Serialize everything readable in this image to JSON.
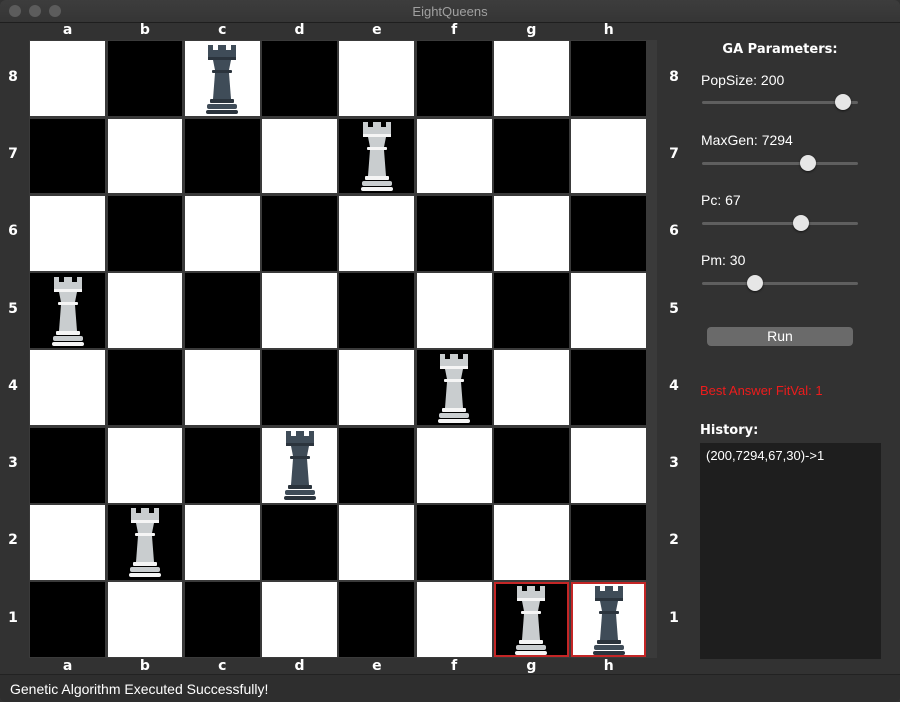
{
  "window": {
    "title": "EightQueens"
  },
  "board": {
    "files": [
      "a",
      "b",
      "c",
      "d",
      "e",
      "f",
      "g",
      "h"
    ],
    "ranks": [
      "8",
      "7",
      "6",
      "5",
      "4",
      "3",
      "2",
      "1"
    ],
    "colors": {
      "light": "#ffffff",
      "dark": "#000000",
      "highlight": "#c42626"
    },
    "pieces": [
      {
        "file": "c",
        "rank": "8",
        "piece": "rook-icon",
        "color": "dark"
      },
      {
        "file": "e",
        "rank": "7",
        "piece": "rook-icon",
        "color": "light"
      },
      {
        "file": "a",
        "rank": "5",
        "piece": "rook-icon",
        "color": "light"
      },
      {
        "file": "f",
        "rank": "4",
        "piece": "rook-icon",
        "color": "light"
      },
      {
        "file": "d",
        "rank": "3",
        "piece": "rook-icon",
        "color": "dark"
      },
      {
        "file": "b",
        "rank": "2",
        "piece": "rook-icon",
        "color": "light"
      },
      {
        "file": "g",
        "rank": "1",
        "piece": "rook-icon",
        "color": "light"
      },
      {
        "file": "h",
        "rank": "1",
        "piece": "rook-icon",
        "color": "dark"
      }
    ],
    "highlighted": [
      {
        "file": "g",
        "rank": "1"
      },
      {
        "file": "h",
        "rank": "1"
      }
    ]
  },
  "ga": {
    "title": "GA Parameters:",
    "params": [
      {
        "label": "PopSize: 200",
        "value": 200,
        "level": 0.95
      },
      {
        "label": "MaxGen: 7294",
        "value": 7294,
        "level": 0.7
      },
      {
        "label": "Pc: 67",
        "value": 67,
        "level": 0.65
      },
      {
        "label": "Pm: 30",
        "value": 30,
        "level": 0.32
      }
    ],
    "run_label": "Run",
    "best_answer": "Best Answer FitVal: 1",
    "best_color": "#ee1c1c",
    "history_title": "History:",
    "history": [
      "(200,7294,67,30)->1"
    ]
  },
  "status": {
    "text": "Genetic Algorithm Executed Successfully!"
  }
}
